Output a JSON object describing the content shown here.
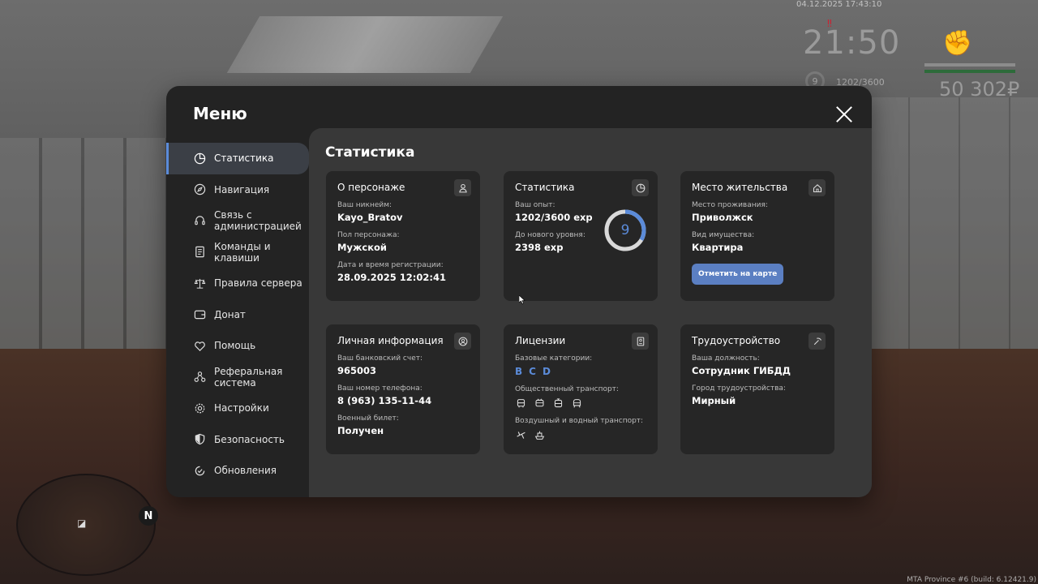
{
  "hud": {
    "datetime": "04.12.2025 17:43:10",
    "time": "21:50",
    "level": "9",
    "exp": "1202/3600",
    "money": "50 302₽",
    "health_color": "#9a9a9a",
    "armor_color": "#2d6b3a",
    "accent": "#5b8bd9"
  },
  "build_info": "MTA Province #6 (build: 6.12421.9)",
  "menu": {
    "title": "Меню",
    "content_title": "Статистика"
  },
  "sidebar": {
    "items": [
      {
        "label": "Статистика",
        "icon": "pie-chart-icon",
        "active": true
      },
      {
        "label": "Навигация",
        "icon": "compass-icon"
      },
      {
        "label": "Связь с\nадминистрацией",
        "icon": "headset-icon"
      },
      {
        "label": "Команды и\nклавиши",
        "icon": "document-icon"
      },
      {
        "label": "Правила сервера",
        "icon": "scales-icon"
      },
      {
        "label": "Донат",
        "icon": "wallet-icon"
      },
      {
        "label": "Помощь",
        "icon": "heart-hand-icon"
      },
      {
        "label": "Реферальная\nсистема",
        "icon": "network-icon"
      },
      {
        "label": "Настройки",
        "icon": "gear-icon"
      },
      {
        "label": "Безопасность",
        "icon": "shield-icon"
      },
      {
        "label": "Обновления",
        "icon": "refresh-check-icon"
      }
    ]
  },
  "cards": {
    "character": {
      "title": "О персонаже",
      "nickname_label": "Ваш никнейм:",
      "nickname": "Kayo_Bratov",
      "gender_label": "Пол персонажа:",
      "gender": "Мужской",
      "reg_label": "Дата и время регистрации:",
      "reg_date": "28.09.2025 12:02:41"
    },
    "stats": {
      "title": "Статистика",
      "exp_label": "Ваш опыт:",
      "exp": "1202/3600 exp",
      "next_label": "До нового уровня:",
      "next": "2398 exp",
      "level": "9",
      "progress": 0.334
    },
    "residence": {
      "title": "Место жительства",
      "place_label": "Место проживания:",
      "place": "Приволжск",
      "property_label": "Вид имущества:",
      "property": "Квартира",
      "map_button": "Отметить на карте"
    },
    "personal": {
      "title": "Личная информация",
      "bank_label": "Ваш банковский счет:",
      "bank": "965003",
      "phone_label": "Ваш номер телефона:",
      "phone": "8 (963) 135-11-44",
      "military_label": "Военный билет:",
      "military": "Получен"
    },
    "licenses": {
      "title": "Лицензии",
      "base_label": "Базовые категории:",
      "categories": [
        "B",
        "C",
        "D"
      ],
      "public_label": "Общественный транспорт:",
      "public_icons": [
        "bus-icon",
        "trolleybus-icon",
        "tram-icon",
        "train-icon"
      ],
      "air_water_label": "Воздушный и водный транспорт:",
      "air_water_icons": [
        "plane-icon",
        "boat-icon"
      ]
    },
    "employment": {
      "title": "Трудоустройство",
      "position_label": "Ваша должность:",
      "position": "Сотрудник ГИБДД",
      "city_label": "Город трудоустройства:",
      "city": "Мирный"
    }
  }
}
